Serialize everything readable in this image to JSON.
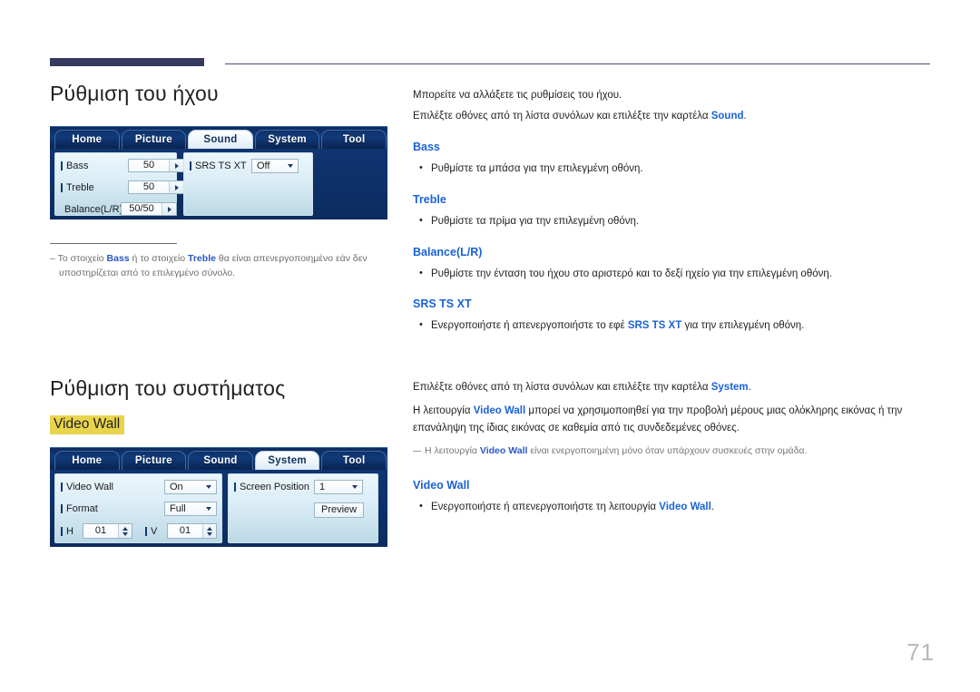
{
  "page": {
    "number": "71"
  },
  "sections": [
    {
      "id": "sound",
      "title": "Ρύθμιση του ήχου",
      "intro": [
        "Μπορείτε να αλλάξετε τις ρυθμίσεις του ήχου.",
        "Επιλέξτε οθόνες από τη λίστα συνόλων και επιλέξτε την καρτέλα "
      ],
      "intro_link": "Sound",
      "intro_tail": ".",
      "note": {
        "prefix": "–",
        "part1": "Το στοιχείο ",
        "bold1": "Bass",
        "part2": " ή το στοιχείο ",
        "bold2": "Treble",
        "part3": " θα είναι απενεργοποιημένο εάν δεν υποστηρίζεται από το επιλεγμένο σύνολο."
      },
      "options": [
        {
          "name": "Bass",
          "desc": "Ρυθμίστε τα μπάσα για την επιλεγμένη οθόνη."
        },
        {
          "name": "Treble",
          "desc": "Ρυθμίστε τα πρίμα για την επιλεγμένη οθόνη."
        },
        {
          "name": "Balance(L/R)",
          "desc": "Ρυθμίστε την ένταση του ήχου στο αριστερό και το δεξί ηχείο για την επιλεγμένη οθόνη."
        },
        {
          "name": "SRS TS XT",
          "desc_pre": "Ενεργοποιήστε ή απενεργοποιήστε το εφέ ",
          "desc_link": "SRS TS XT",
          "desc_post": " για την επιλεγμένη οθόνη."
        }
      ]
    },
    {
      "id": "system",
      "title": "Ρύθμιση του συστήματος",
      "highlight_label": "Video Wall",
      "intro_pre": "Επιλέξτε οθόνες από τη λίστα συνόλων και επιλέξτε την καρτέλα ",
      "intro_link": "System",
      "intro_post": ".",
      "para2_pre": "Η λειτουργία ",
      "para2_link": "Video Wall",
      "para2_post": " μπορεί να χρησιμοποιηθεί για την προβολή μέρους μιας ολόκληρης εικόνας ή την επανάληψη της ίδιας εικόνας σε καθεμία από τις συνδεδεμένες οθόνες.",
      "note_pre": "Η λειτουργία ",
      "note_link": "Video Wall",
      "note_post": " είναι ενεργοποιημένη μόνο όταν υπάρχουν συσκευές στην ομάδα.",
      "option": {
        "name": "Video Wall",
        "desc_pre": "Ενεργοποιήστε ή απενεργοποιήστε τη λειτουργία ",
        "desc_link": "Video Wall",
        "desc_post": "."
      }
    }
  ],
  "osd_sound": {
    "tabs": [
      "Home",
      "Picture",
      "Sound",
      "System",
      "Tool"
    ],
    "active_tab": "Sound",
    "left_rows": [
      {
        "label": "Bass",
        "value": "50",
        "control": "spinner-right-arrow"
      },
      {
        "label": "Treble",
        "value": "50",
        "control": "spinner-right-arrow"
      },
      {
        "label": "Balance(L/R)",
        "value": "50/50",
        "control": "spinner-right-arrow"
      }
    ],
    "right_rows": [
      {
        "label": "SRS TS XT",
        "value": "Off",
        "control": "combobox"
      }
    ]
  },
  "osd_system": {
    "tabs": [
      "Home",
      "Picture",
      "Sound",
      "System",
      "Tool"
    ],
    "active_tab": "System",
    "left_rows": [
      {
        "label": "Video Wall",
        "value": "On",
        "control": "combobox"
      },
      {
        "label": "Format",
        "value": "Full",
        "control": "combobox"
      }
    ],
    "left_steppers": [
      {
        "label": "H",
        "value": "01"
      },
      {
        "label": "V",
        "value": "01"
      }
    ],
    "right_rows": [
      {
        "label": "Screen Position",
        "value": "1",
        "control": "combobox"
      }
    ],
    "preview_button": "Preview"
  },
  "colors": {
    "accent_blue": "#1a62d6",
    "highlight_yellow": "#e8d44d",
    "header_navy": "#363a5e",
    "osd_dark_blue": "#0d2b5e"
  }
}
